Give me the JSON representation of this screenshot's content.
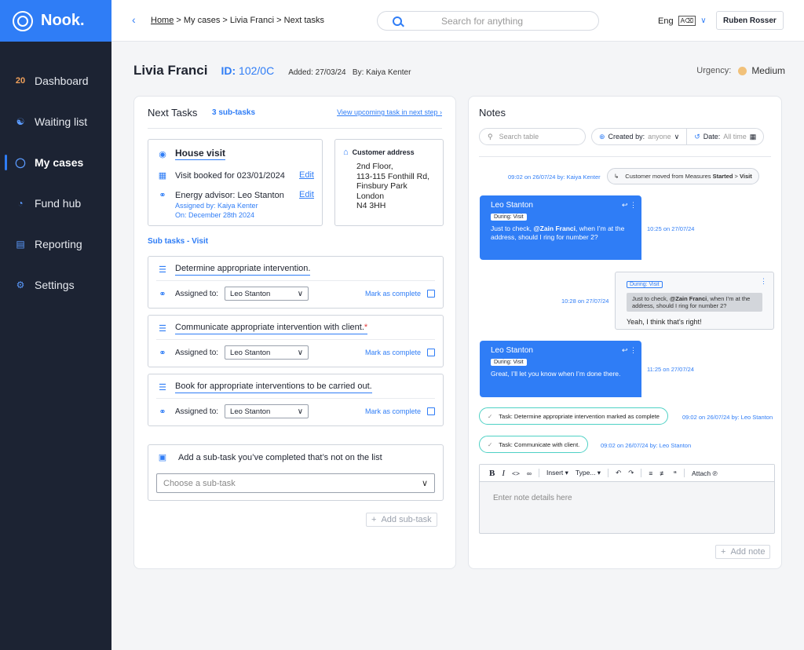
{
  "app": {
    "logo": "Nook."
  },
  "sidebar": {
    "items": [
      {
        "label": "Dashboard",
        "badge": "20"
      },
      {
        "label": "Waiting list"
      },
      {
        "label": "My cases"
      },
      {
        "label": "Fund hub"
      },
      {
        "label": "Reporting"
      },
      {
        "label": "Settings"
      }
    ]
  },
  "topbar": {
    "back": "‹",
    "breadcrumb": {
      "home": "Home",
      "rest": " > My cases > Livia Franci > Next tasks"
    },
    "search_placeholder": "Search for anything",
    "language": "Eng",
    "user": "Ruben Rosser"
  },
  "case": {
    "name": "Livia Franci",
    "id_label": "ID:",
    "id_value": "102/0C",
    "meta": "Added: 27/03/24   By: Kaiya Kenter",
    "urgency_label": "Urgency:",
    "urgency_value": "Medium",
    "urgency_color": "#f1c17a"
  },
  "tasks": {
    "title": "Next Tasks",
    "count": "3 sub-tasks",
    "upcoming_link": "View upcoming task in next step",
    "visit": {
      "title": "House visit",
      "booked": "Visit booked for 023/01/2024",
      "advisor": "Energy advisor: Leo Stanton",
      "assigned_by": "Assigned by: Kaiya Kenter",
      "assigned_on": "On: December 28th 2024",
      "edit": "Edit"
    },
    "address": {
      "title": "Customer address",
      "lines": [
        "2nd Floor,",
        "113-115 Fonthill Rd,",
        "Finsbury Park",
        "London",
        "N4 3HH"
      ]
    },
    "subtasks_label": "Sub tasks - Visit",
    "assigned_label": "Assigned to:",
    "mark_label": "Mark as complete",
    "subtasks": [
      {
        "title": "Determine appropriate intervention.",
        "required": "",
        "assignee": "Leo Stanton"
      },
      {
        "title": "Communicate appropriate intervention with client.",
        "required": "*",
        "assignee": "Leo Stanton"
      },
      {
        "title": "Book for appropriate interventions to be carried out.",
        "required": "",
        "assignee": "Leo Stanton"
      }
    ],
    "add_heading": "Add a sub-task you’ve completed that’s not on the list",
    "add_placeholder": "Choose a sub-task",
    "add_button": "Add sub-task"
  },
  "notes": {
    "title": "Notes",
    "search_placeholder": "Search table",
    "created_label": "Created by:",
    "created_value": "anyone",
    "date_label": "Date:",
    "date_value": "All time",
    "system_time": "09:02 on 26/07/24",
    "system_by": "by: Kaiya Kenter",
    "system_text_a": "Customer moved from Measures ",
    "system_text_b": "Started",
    "system_text_c": " > ",
    "system_text_d": "Visit",
    "messages": [
      {
        "name": "Leo Stanton",
        "tag": "During: Visit",
        "text_a": "Just to check, ",
        "mention": "@Zain Franci",
        "text_b": ", when I’m at the address, should I ring for number 2?",
        "time": "10:25 on 27/07/24"
      },
      {
        "name": "Leo Stanton",
        "tag": "During: Visit",
        "text": "Great, I’ll let you know when I’m done there.",
        "time": "11:25 on 27/07/24"
      }
    ],
    "reply": {
      "tag": "During: Visit",
      "quote_a": "Just to check, ",
      "quote_mention": "@Zain Franci",
      "quote_b": ", when I’m at the address, should I ring for number 2?",
      "text": "Yeah, I think that’s right!",
      "time": "10:28 on 27/07/24"
    },
    "task_events": [
      {
        "text": "Task: Determine appropriate intervention marked as complete",
        "time": "09:02 on 26/07/24",
        "by": "by: Leo Stanton"
      },
      {
        "text": "Task: Communicate with client.",
        "time": "09:02 on 26/07/24",
        "by": "by: Leo Stanton"
      }
    ],
    "toolbar": {
      "insert": "Insert",
      "type": "Type...",
      "attach": "Attach"
    },
    "editor_placeholder": "Enter note details here",
    "add_button": "Add note"
  },
  "colors": {
    "accent": "#2f7df6",
    "sidebar": "#1c2333",
    "task_border": "#4fd1c5"
  }
}
